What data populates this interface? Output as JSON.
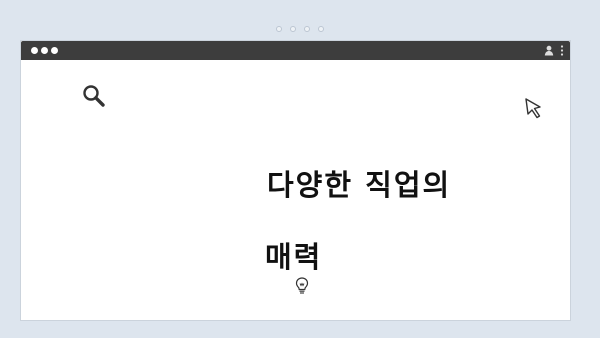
{
  "window": {
    "title_bar_color": "#3d3d3d",
    "window_controls": [
      "dot",
      "dot",
      "dot"
    ],
    "toolbar_icons": [
      "profile-icon",
      "kebab-menu-icon"
    ]
  },
  "pager": {
    "dots": 4
  },
  "content": {
    "headline_line1": "다양한 직업의",
    "headline_line2": "매력",
    "icons": [
      "search-icon",
      "cursor-icon",
      "lightbulb-icon"
    ]
  }
}
